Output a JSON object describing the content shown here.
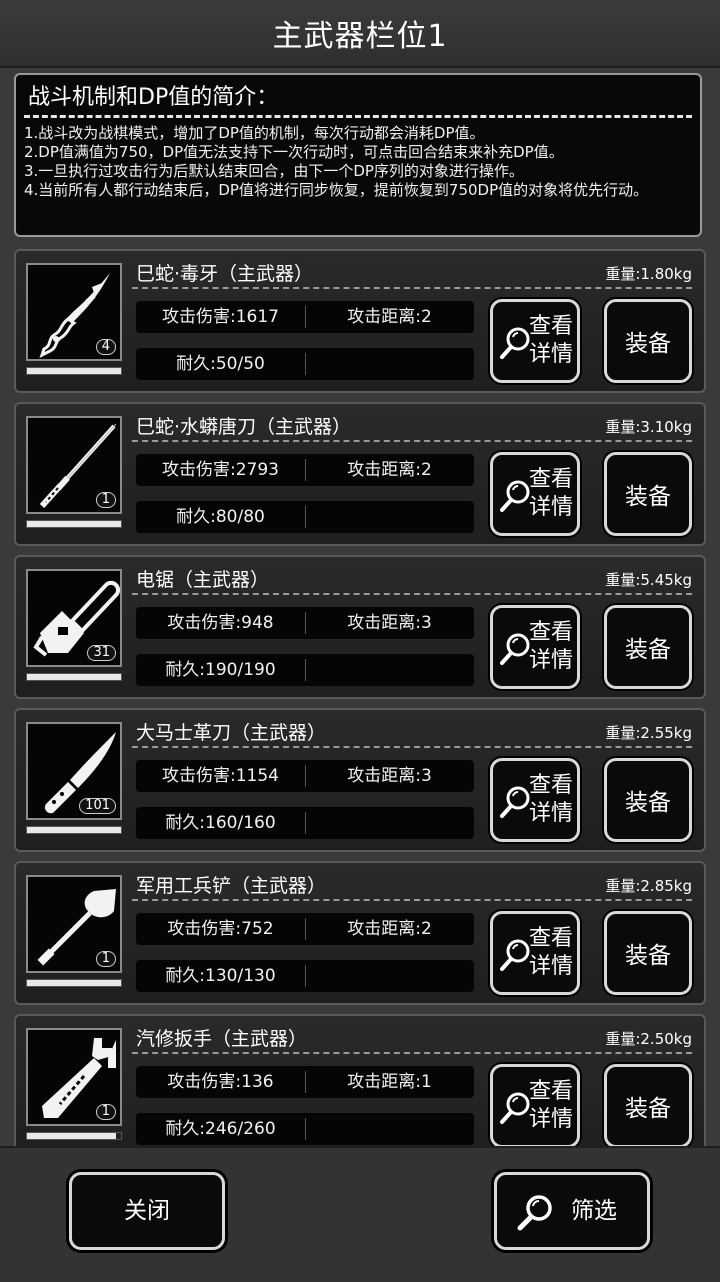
{
  "header": {
    "title": "主武器栏位1"
  },
  "intro": {
    "title": "战斗机制和DP值的简介：",
    "lines": [
      "1.战斗改为战棋模式，增加了DP值的机制，每次行动都会消耗DP值。",
      "2.DP值满值为750，DP值无法支持下一次行动时，可点击回合结束来补充DP值。",
      "3.一旦执行过攻击行为后默认结束回合，由下一个DP序列的对象进行操作。",
      "4.当前所有人都行动结束后，DP值将进行同步恢复，提前恢复到750DP值的对象将优先行动。"
    ]
  },
  "weapons": [
    {
      "name": "巳蛇·毒牙（主武器）",
      "weight": "重量:1.80kg",
      "attack": "攻击伤害:1617",
      "range": "攻击距离:2",
      "durability": "耐久:50/50",
      "count": "4",
      "durability_fraction": 1.0,
      "icon": "serpent-fang-blade-icon"
    },
    {
      "name": "巳蛇·水蟒唐刀（主武器）",
      "weight": "重量:3.10kg",
      "attack": "攻击伤害:2793",
      "range": "攻击距离:2",
      "durability": "耐久:80/80",
      "count": "1",
      "durability_fraction": 1.0,
      "icon": "tang-sword-icon"
    },
    {
      "name": "电锯（主武器）",
      "weight": "重量:5.45kg",
      "attack": "攻击伤害:948",
      "range": "攻击距离:3",
      "durability": "耐久:190/190",
      "count": "31",
      "durability_fraction": 1.0,
      "icon": "chainsaw-icon"
    },
    {
      "name": "大马士革刀（主武器）",
      "weight": "重量:2.55kg",
      "attack": "攻击伤害:1154",
      "range": "攻击距离:3",
      "durability": "耐久:160/160",
      "count": "101",
      "durability_fraction": 1.0,
      "icon": "damascus-knife-icon"
    },
    {
      "name": "军用工兵铲（主武器）",
      "weight": "重量:2.85kg",
      "attack": "攻击伤害:752",
      "range": "攻击距离:2",
      "durability": "耐久:130/130",
      "count": "1",
      "durability_fraction": 1.0,
      "icon": "shovel-icon"
    },
    {
      "name": "汽修扳手（主武器）",
      "weight": "重量:2.50kg",
      "attack": "攻击伤害:136",
      "range": "攻击距离:1",
      "durability": "耐久:246/260",
      "count": "1",
      "durability_fraction": 0.946,
      "icon": "wrench-icon"
    }
  ],
  "buttons": {
    "detail_line1": "查看",
    "detail_line2": "详情",
    "equip": "装备",
    "close": "关闭",
    "filter": "筛选"
  }
}
